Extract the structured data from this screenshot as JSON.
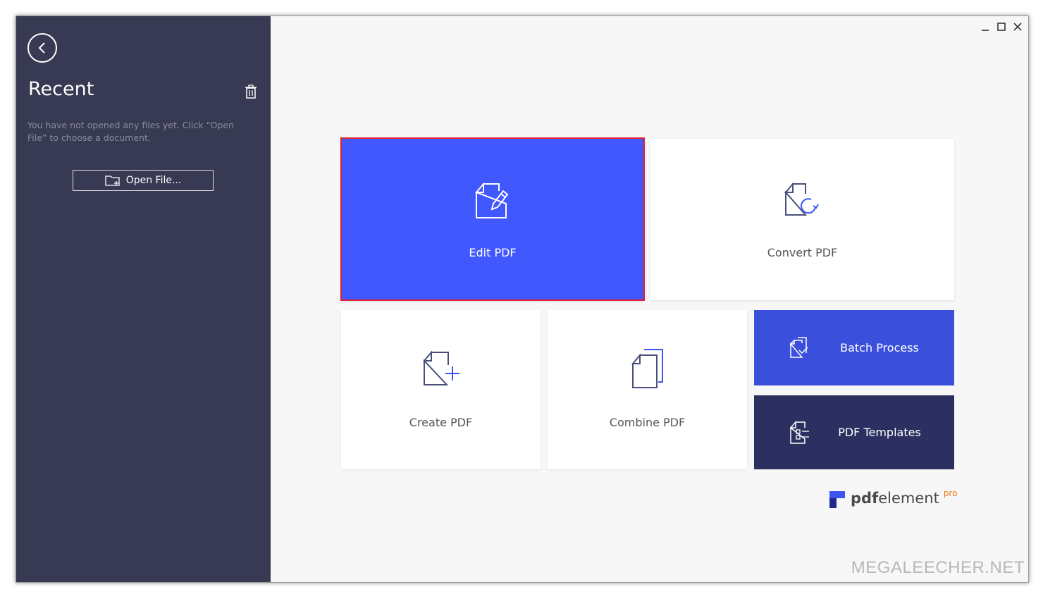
{
  "sidebar": {
    "title": "Recent",
    "hint": "You have not opened any files yet. Click “Open File” to choose a document.",
    "open_file_label": "Open File..."
  },
  "tiles": {
    "edit": "Edit PDF",
    "convert": "Convert PDF",
    "create": "Create PDF",
    "combine": "Combine PDF",
    "batch": "Batch Process",
    "templates": "PDF Templates"
  },
  "brand": {
    "bold": "pdf",
    "regular": "element",
    "sup": "pro"
  },
  "watermark": "MEGALEECHER.NET",
  "colors": {
    "sidebar": "#373a52",
    "edit_tile": "#4158ff",
    "edit_border": "#e3202b",
    "batch_tile": "#3a4fdc",
    "templates_tile": "#2c3060",
    "brand_pro": "#f07a1a"
  }
}
